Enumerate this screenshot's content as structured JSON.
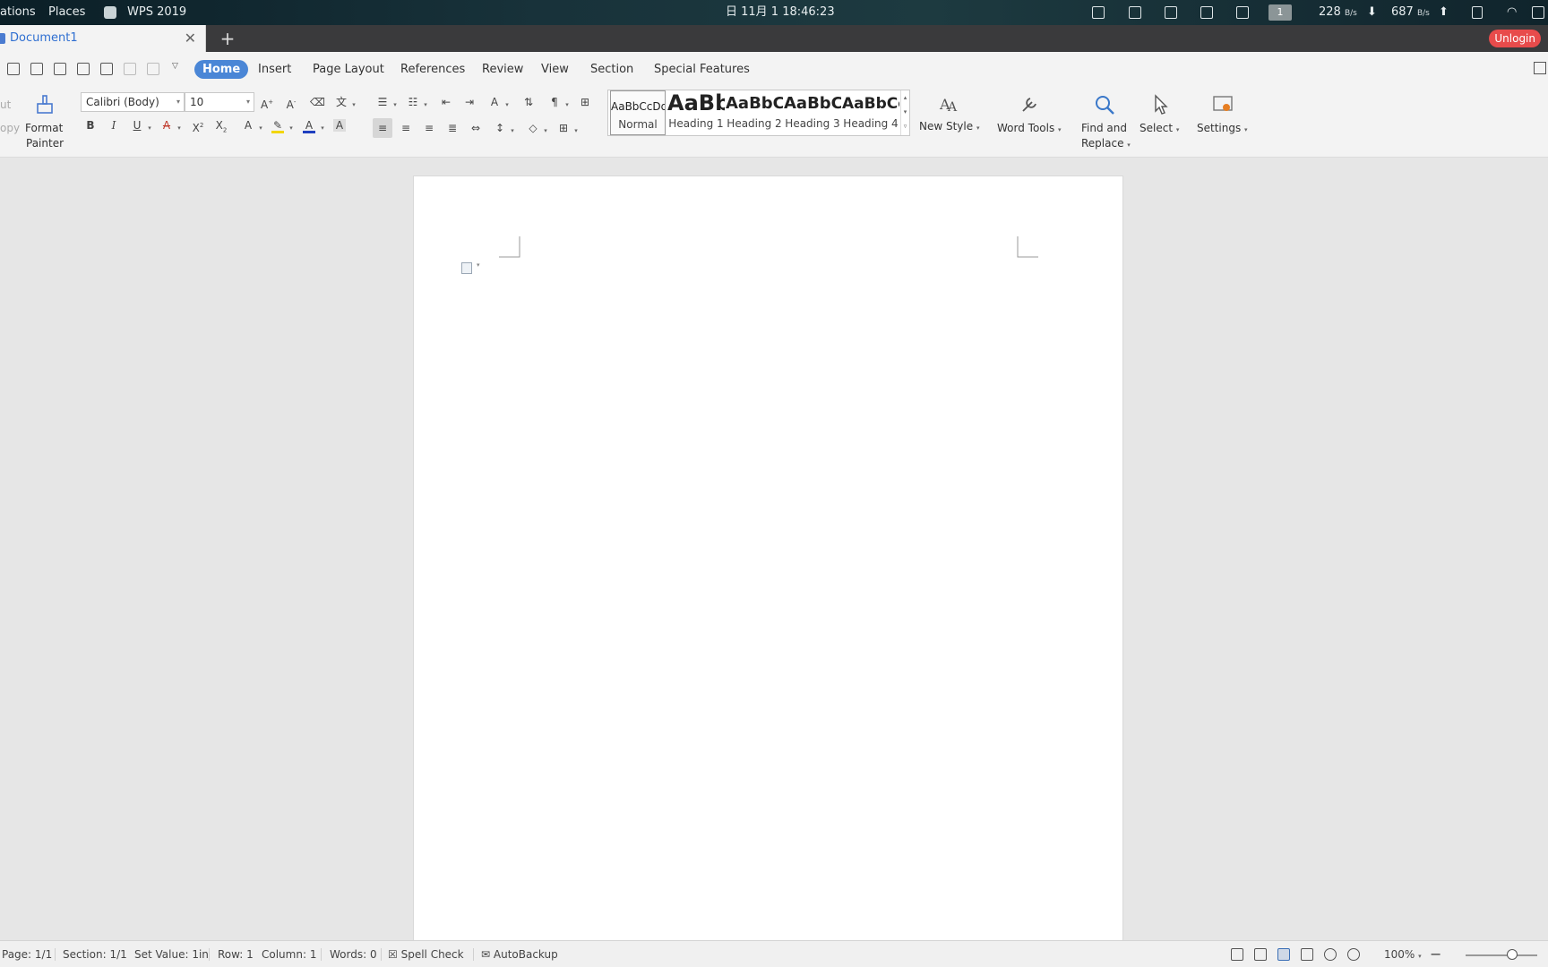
{
  "system_bar": {
    "apps_menu": "ations",
    "places_menu": "Places",
    "active_app": "WPS 2019",
    "clock": "日 11月 1  18:46:23",
    "workspace": "1",
    "net_down": "228",
    "net_down_unit": "B/s",
    "net_up": "687",
    "net_up_unit": "B/s"
  },
  "tabs": {
    "document_title": "Document1",
    "new_tab": "+",
    "unlogin": "Unlogin"
  },
  "menu": {
    "tabs": [
      "Home",
      "Insert",
      "Page Layout",
      "References",
      "Review",
      "View",
      "Section",
      "Special Features"
    ],
    "active_tab": "Home"
  },
  "ribbon": {
    "cut_label": "ut",
    "copy_label": "opy",
    "format_painter_line1": "Format",
    "format_painter_line2": "Painter",
    "font_name": "Calibri (Body)",
    "font_size": "10",
    "styles": [
      {
        "preview": "AaBbCcDd",
        "label": "Normal"
      },
      {
        "preview": "AaBb",
        "label": "Heading 1"
      },
      {
        "preview": "AaBbC",
        "label": "Heading 2"
      },
      {
        "preview": "AaBbC",
        "label": "Heading 3"
      },
      {
        "preview": "AaBbCc",
        "label": "Heading 4"
      }
    ],
    "selected_style": "Normal",
    "new_style": "New Style",
    "word_tools": "Word Tools",
    "find_replace_line1": "Find and",
    "find_replace_line2": "Replace",
    "select": "Select",
    "settings": "Settings"
  },
  "status": {
    "page": "Page: 1/1",
    "section": "Section: 1/1",
    "set_value": "Set Value: 1in",
    "row": "Row: 1",
    "column": "Column: 1",
    "words": "Words: 0",
    "spell_check": "Spell Check",
    "auto_backup": "AutoBackup",
    "zoom": "100%",
    "zoom_level": 1.0
  },
  "colors": {
    "accent": "#4a86d6",
    "unlogin": "#e84b4b",
    "tab_title": "#2f6fd1"
  }
}
